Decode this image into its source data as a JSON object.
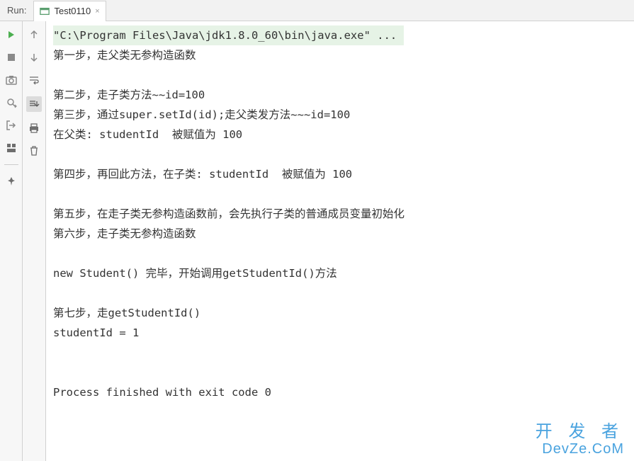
{
  "header": {
    "run_label": "Run:",
    "tab_title": "Test0110",
    "tab_close": "×"
  },
  "toolbar1": {
    "play": "▶",
    "stop": "■",
    "camera": "📷",
    "bug": "🐞",
    "exit": "⎘",
    "layout": "▣",
    "pin": "📌"
  },
  "toolbar2": {
    "up": "↑",
    "down": "↓",
    "wrap": "⇉",
    "scroll": "⇲",
    "print": "🖨",
    "trash": "🗑"
  },
  "console": [
    {
      "text": "\"C:\\Program Files\\Java\\jdk1.8.0_60\\bin\\java.exe\" ...",
      "hl": true
    },
    {
      "text": "第一步，走父类无参构造函数"
    },
    {
      "text": ""
    },
    {
      "text": "第二步，走子类方法~~id=100"
    },
    {
      "text": "第三步，通过super.setId(id);走父类发方法~~~id=100"
    },
    {
      "text": "在父类: studentId  被赋值为 100"
    },
    {
      "text": ""
    },
    {
      "text": "第四步，再回此方法，在子类: studentId  被赋值为 100"
    },
    {
      "text": ""
    },
    {
      "text": "第五步，在走子类无参构造函数前，会先执行子类的普通成员变量初始化"
    },
    {
      "text": "第六步，走子类无参构造函数"
    },
    {
      "text": ""
    },
    {
      "text": "new Student() 完毕，开始调用getStudentId()方法"
    },
    {
      "text": ""
    },
    {
      "text": "第七步，走getStudentId()"
    },
    {
      "text": "studentId = 1"
    },
    {
      "text": ""
    },
    {
      "text": ""
    },
    {
      "text": "Process finished with exit code 0"
    }
  ],
  "watermark": {
    "line1": "开 发 者",
    "line2": "DevZe.CoM"
  }
}
